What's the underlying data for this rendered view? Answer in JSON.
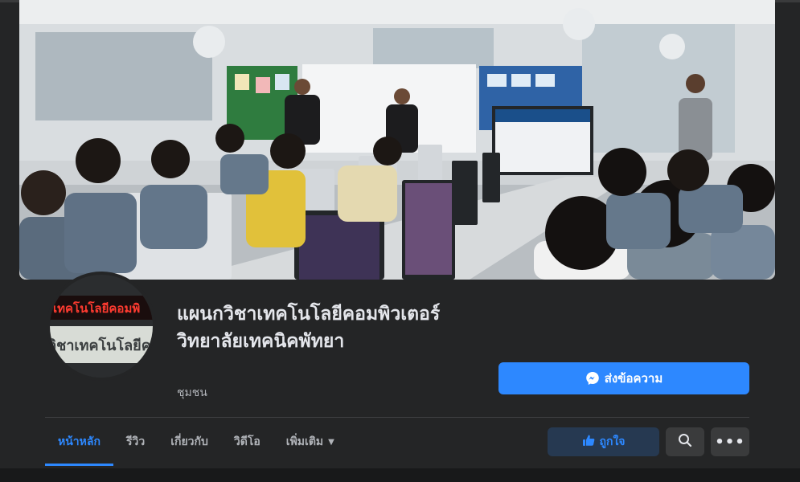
{
  "page": {
    "title": "แผนกวิชาเทคโนโลยีคอมพิวเตอร์ วิทยาลัยเทคนิคพัทยา",
    "category": "ชุมชน",
    "avatar_text_top": "เทคโนโลยีคอมพิ",
    "avatar_text_bottom": "วิชาเทคโนโลยีคอมพิ"
  },
  "actions": {
    "message_label": "ส่งข้อความ",
    "like_label": "ถูกใจ",
    "more_label": "•••"
  },
  "tabs": [
    {
      "label": "หน้าหลัก",
      "active": true
    },
    {
      "label": "รีวิว",
      "active": false
    },
    {
      "label": "เกี่ยวกับ",
      "active": false
    },
    {
      "label": "วิดีโอ",
      "active": false
    },
    {
      "label": "เพิ่มเติม",
      "active": false,
      "dropdown": true
    }
  ],
  "colors": {
    "accent": "#2d88ff",
    "background": "#18191a",
    "surface": "#242526",
    "button": "#3a3b3c"
  },
  "icons": {
    "message": "messenger-icon",
    "like": "thumbs-up-icon",
    "search": "search-icon",
    "more": "more-dots-icon",
    "dropdown": "caret-down-icon"
  }
}
